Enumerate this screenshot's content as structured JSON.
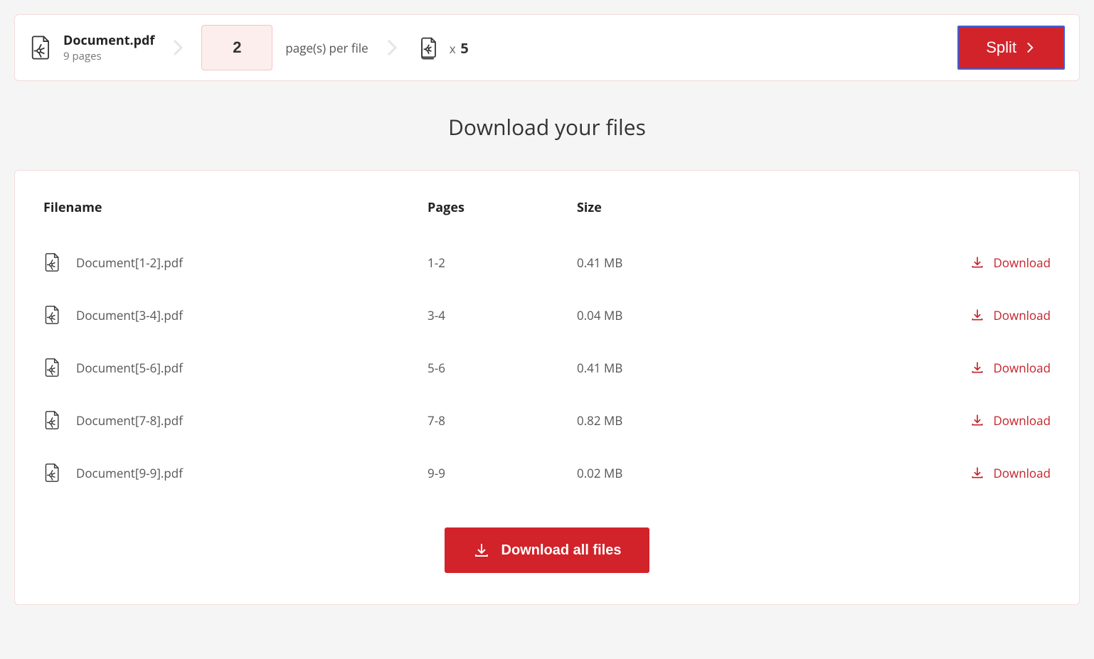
{
  "header": {
    "doc_name": "Document.pdf",
    "doc_pages": "9 pages",
    "pages_per_file_value": "2",
    "pages_per_file_label": "page(s) per file",
    "output_prefix": "x",
    "output_count": "5",
    "split_label": "Split"
  },
  "section_title": "Download your files",
  "table": {
    "headers": {
      "filename": "Filename",
      "pages": "Pages",
      "size": "Size"
    },
    "download_label": "Download",
    "rows": [
      {
        "filename": "Document[1-2].pdf",
        "pages": "1-2",
        "size": "0.41 MB"
      },
      {
        "filename": "Document[3-4].pdf",
        "pages": "3-4",
        "size": "0.04 MB"
      },
      {
        "filename": "Document[5-6].pdf",
        "pages": "5-6",
        "size": "0.41 MB"
      },
      {
        "filename": "Document[7-8].pdf",
        "pages": "7-8",
        "size": "0.82 MB"
      },
      {
        "filename": "Document[9-9].pdf",
        "pages": "9-9",
        "size": "0.02 MB"
      }
    ]
  },
  "download_all_label": "Download all files"
}
